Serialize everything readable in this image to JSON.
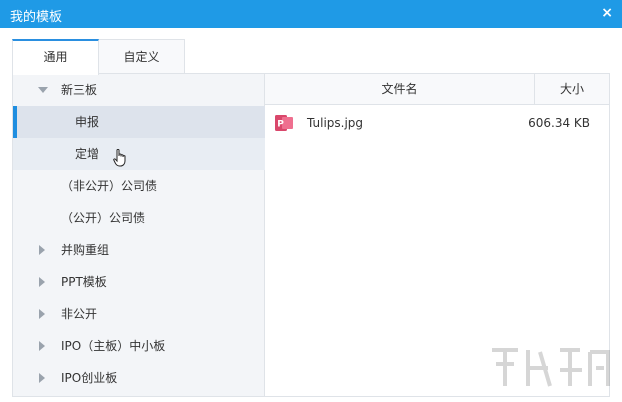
{
  "window": {
    "title": "我的模板",
    "close_glyph": "×"
  },
  "tabs": [
    {
      "label": "通用",
      "active": true
    },
    {
      "label": "自定义",
      "active": false
    }
  ],
  "tree": {
    "items": [
      {
        "label": "新三板",
        "expanded": true,
        "level": 0,
        "icon": "caret-down-icon"
      },
      {
        "label": "申报",
        "level": 1,
        "selected": true
      },
      {
        "label": "定增",
        "level": 1,
        "hover": true
      },
      {
        "label": "（非公开）公司债",
        "level": 0.5
      },
      {
        "label": "（公开）公司债",
        "level": 0.5
      },
      {
        "label": "并购重组",
        "level": 0,
        "expanded": false,
        "icon": "caret-right-icon"
      },
      {
        "label": "PPT模板",
        "level": 0,
        "expanded": false,
        "icon": "caret-right-icon"
      },
      {
        "label": "非公开",
        "level": 0,
        "expanded": false,
        "icon": "caret-right-icon"
      },
      {
        "label": "IPO（主板）中小板",
        "level": 0,
        "expanded": false,
        "icon": "caret-right-icon"
      },
      {
        "label": "IPO创业板",
        "level": 0,
        "expanded": false,
        "icon": "caret-right-icon"
      }
    ]
  },
  "files": {
    "columns": {
      "name": "文件名",
      "size": "大小"
    },
    "rows": [
      {
        "name": "Tulips.jpg",
        "size": "606.34 KB",
        "icon": "powerpoint-file-icon"
      }
    ]
  },
  "colors": {
    "titlebar": "#1f9ae6",
    "accent": "#1f8ee0",
    "file_icon": "#d9476b"
  }
}
